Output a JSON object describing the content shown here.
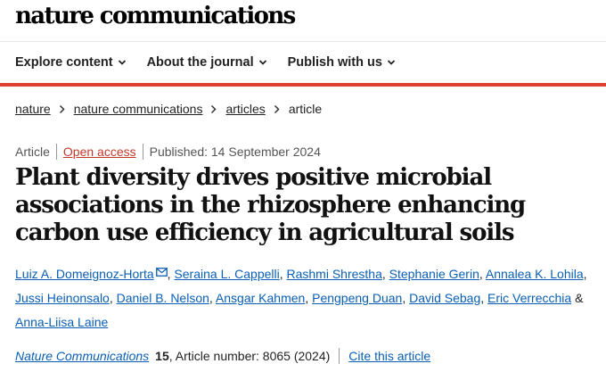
{
  "header": {
    "logo": "nature communications"
  },
  "nav": {
    "items": [
      {
        "label": "Explore content"
      },
      {
        "label": "About the journal"
      },
      {
        "label": "Publish with us"
      }
    ]
  },
  "breadcrumb": {
    "items": [
      "nature",
      "nature communications",
      "articles"
    ],
    "current": "article"
  },
  "article": {
    "type": "Article",
    "access": "Open access",
    "published": "Published: 14 September 2024",
    "title": "Plant diversity drives positive microbial associations in the rhizosphere enhancing carbon use efficiency in agricultural soils",
    "authors": [
      "Luiz A. Domeignoz-Horta",
      "Seraina L. Cappelli",
      "Rashmi Shrestha",
      "Stephanie Gerin",
      "Annalea K. Lohila",
      "Jussi Heinonsalo",
      "Daniel B. Nelson",
      "Ansgar Kahmen",
      "Pengpeng Duan",
      "David Sebag",
      "Eric Verrecchia",
      "Anna-Liisa Laine"
    ],
    "author_separator": ", ",
    "author_final_joiner": " & "
  },
  "citation": {
    "journal": "Nature Communications",
    "volume": "15",
    "article_number": ", Article number: 8065 (2024)",
    "cite_label": "Cite this article"
  },
  "colors": {
    "accent_bar": "#e0402f",
    "link": "#0a5fb4",
    "open_access": "#c0392b"
  }
}
